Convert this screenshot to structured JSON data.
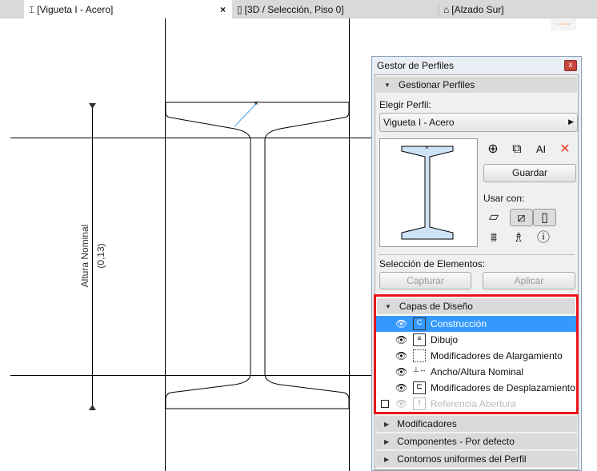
{
  "tabs": [
    {
      "label": "[Vigueta I - Acero]",
      "icon": "i-beam-icon",
      "active": true,
      "close": "×"
    },
    {
      "label": "[3D / Selección, Piso 0]",
      "icon": "3d-box-icon"
    },
    {
      "label": "[Alzado Sur]",
      "icon": "house-icon"
    }
  ],
  "indicator": "----",
  "drawing": {
    "dimension_label": "Altura Nominal",
    "dimension_value": "(0,13)"
  },
  "panel": {
    "title": "Gestor de Perfiles",
    "close": "x",
    "manage": {
      "header": "Gestionar Perfiles",
      "choose_label": "Elegir Perfil:",
      "profile": "Vigueta I - Acero",
      "save": "Guardar",
      "use_with": "Usar con:",
      "delete": "✕",
      "rename": "AI"
    },
    "selection": {
      "label": "Selección de Elementos:",
      "capture": "Capturar",
      "apply": "Aplicar"
    },
    "layers": {
      "header": "Capas de Diseño",
      "items": [
        {
          "label": "Construcción",
          "selected": true
        },
        {
          "label": "Dibujo"
        },
        {
          "label": "Modificadores de Alargamiento"
        },
        {
          "label": "Ancho/Altura Nominal"
        },
        {
          "label": "Modificadores de Desplazamiento"
        },
        {
          "label": "Referencia Abertura",
          "disabled": true
        }
      ]
    },
    "sections": [
      "Modificadores",
      "Componentes - Por defecto",
      "Contornos uniformes del Perfil"
    ]
  },
  "colors": {
    "accent": "#3399ff",
    "highlight": "#e8141b"
  }
}
